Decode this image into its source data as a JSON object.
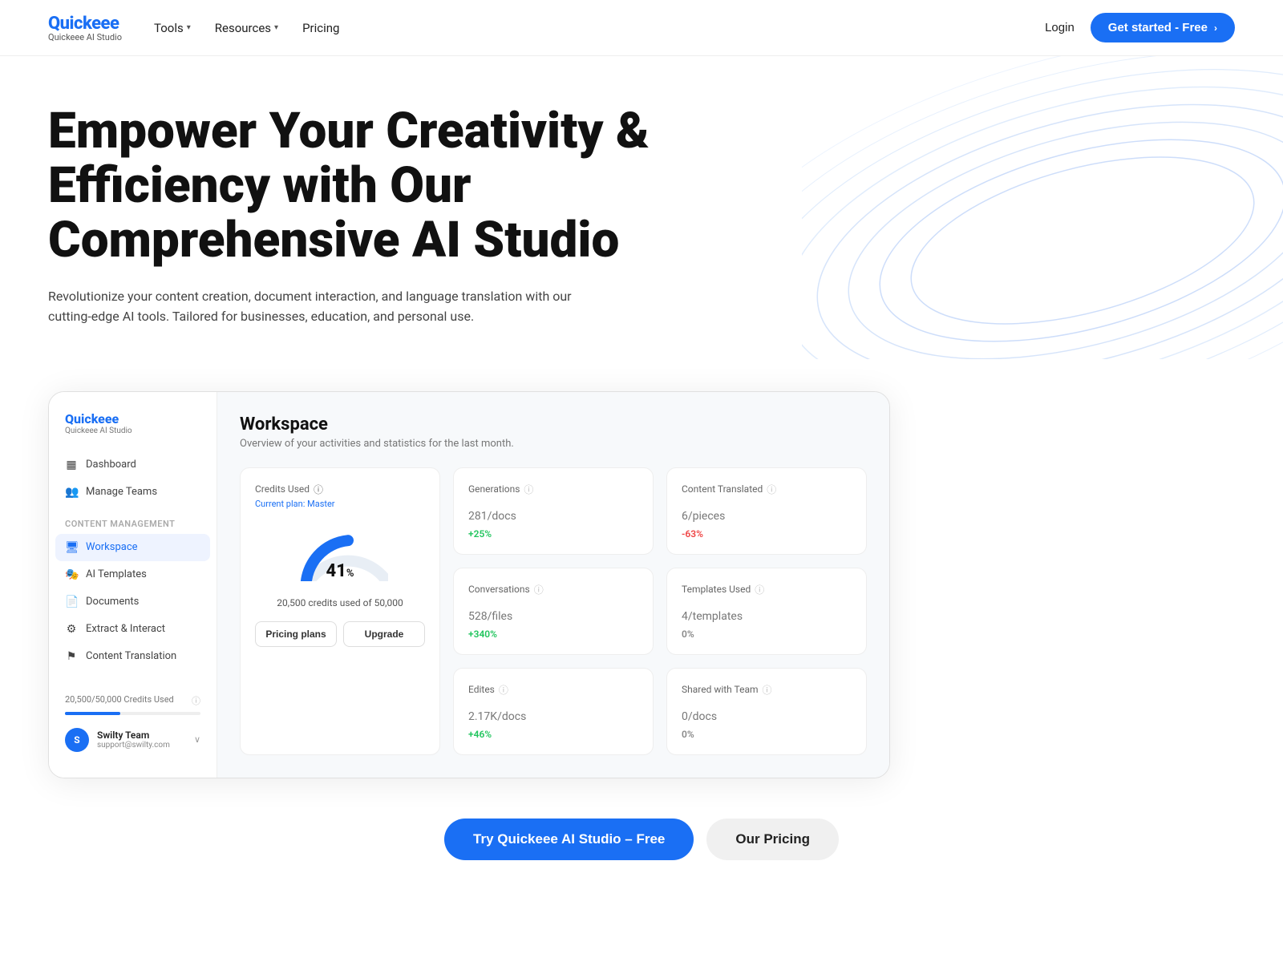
{
  "brand": {
    "name": "Quickeee",
    "sub": "Quickeee AI Studio"
  },
  "nav": {
    "links": [
      {
        "label": "Tools",
        "hasDropdown": true
      },
      {
        "label": "Resources",
        "hasDropdown": true
      },
      {
        "label": "Pricing",
        "hasDropdown": false
      }
    ],
    "login_label": "Login",
    "cta_label": "Get started - Free"
  },
  "hero": {
    "heading": "Empower Your Creativity & Efficiency with Our Comprehensive AI Studio",
    "subtext": "Revolutionize your content creation, document interaction, and language translation with our cutting-edge AI tools. Tailored for businesses, education, and personal use."
  },
  "sidebar": {
    "logo": "Quickeee",
    "logo_sub": "Quickeee AI Studio",
    "nav_items": [
      {
        "label": "Dashboard",
        "icon": "▦",
        "active": false
      },
      {
        "label": "Manage Teams",
        "icon": "👥",
        "active": false
      }
    ],
    "section_label": "Content Management",
    "content_items": [
      {
        "label": "Workspace",
        "icon": "🖥",
        "active": true
      },
      {
        "label": "AI Templates",
        "icon": "🎭",
        "active": false
      },
      {
        "label": "Documents",
        "icon": "📄",
        "active": false
      },
      {
        "label": "Extract & Interact",
        "icon": "⚙",
        "active": false
      },
      {
        "label": "Content Translation",
        "icon": "⚑",
        "active": false
      }
    ],
    "credits_label": "20,500/50,000 Credits Used",
    "user": {
      "name": "Swilty Team",
      "email": "support@swilty.com",
      "initials": "S"
    }
  },
  "workspace": {
    "title": "Workspace",
    "subtitle": "Overview of your activities and statistics for the last month.",
    "stats": [
      {
        "label": "Generations",
        "value": "281",
        "unit": "/docs",
        "change": "+25%",
        "change_type": "pos"
      },
      {
        "label": "Content Translated",
        "value": "6",
        "unit": "/pieces",
        "change": "-63%",
        "change_type": "neg"
      },
      {
        "label": "Conversations",
        "value": "528",
        "unit": "/files",
        "change": "+340%",
        "change_type": "pos"
      },
      {
        "label": "Templates Used",
        "value": "4",
        "unit": "/templates",
        "change": "0%",
        "change_type": "neu"
      },
      {
        "label": "Edites",
        "value": "2.17K",
        "unit": "/docs",
        "change": "+46%",
        "change_type": "pos"
      },
      {
        "label": "Shared with Team",
        "value": "0",
        "unit": "/docs",
        "change": "0%",
        "change_type": "neu"
      }
    ],
    "credits_card": {
      "label": "Credits Used",
      "plan": "Current plan: Master",
      "percent": 41,
      "used_label": "20,500 credits used of 50,000",
      "btn1": "Pricing plans",
      "btn2": "Upgrade"
    }
  },
  "cta": {
    "try_label": "Try Quickeee AI Studio – Free",
    "pricing_label": "Our Pricing"
  }
}
